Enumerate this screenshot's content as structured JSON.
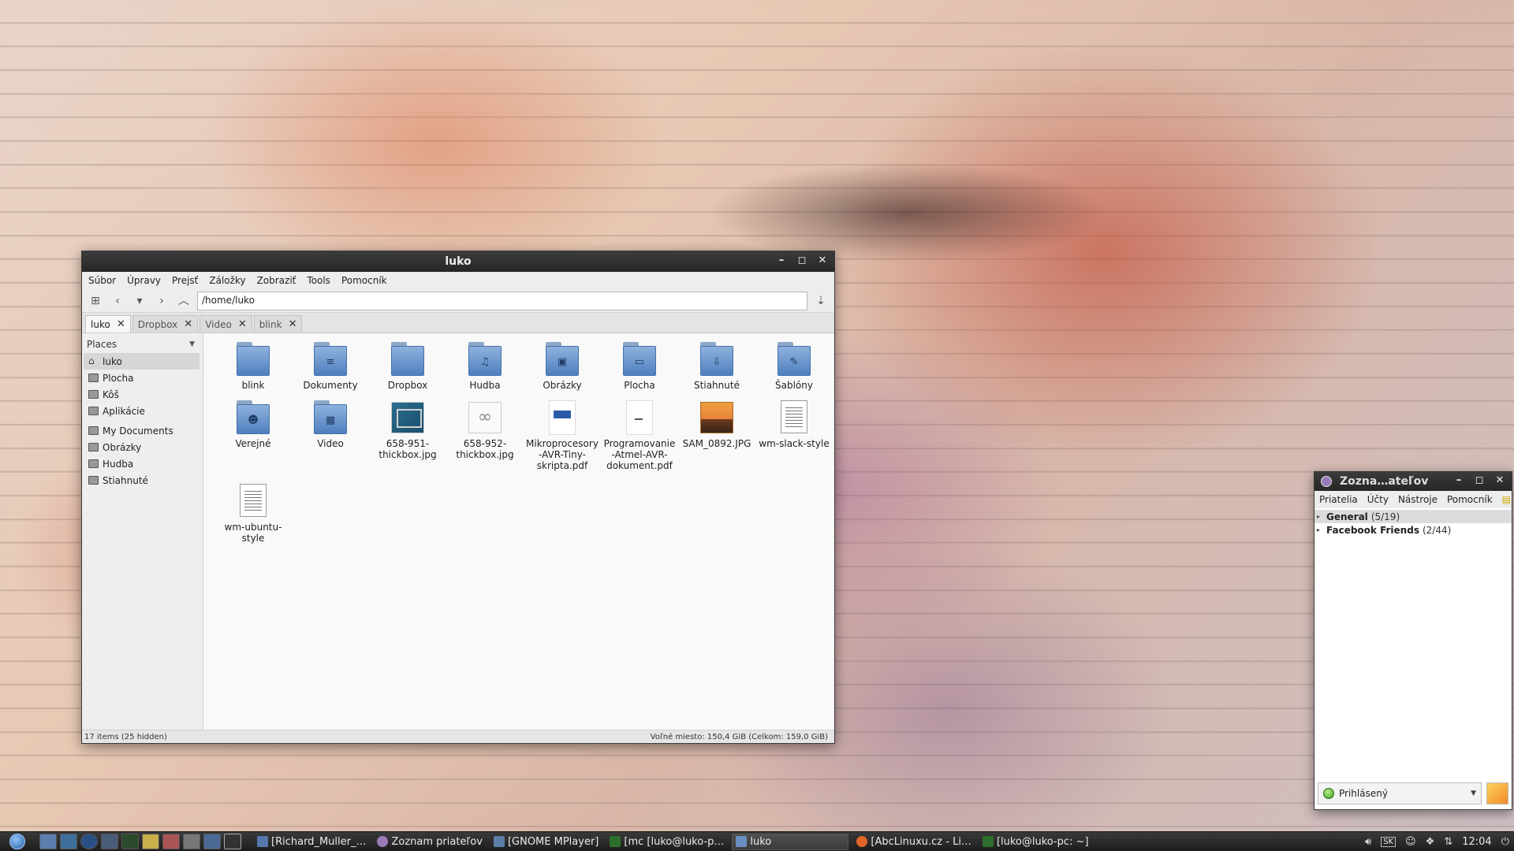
{
  "fm": {
    "title": "luko",
    "menu": [
      "Súbor",
      "Úpravy",
      "Prejsť",
      "Záložky",
      "Zobraziť",
      "Tools",
      "Pomocník"
    ],
    "path": "/home/luko",
    "tabs": [
      "luko",
      "Dropbox",
      "Video",
      "blink"
    ],
    "places_label": "Places",
    "places": [
      "luko",
      "Plocha",
      "Kôš",
      "Aplikácie"
    ],
    "bookmarks": [
      "My Documents",
      "Obrázky",
      "Hudba",
      "Stiahnuté"
    ],
    "files": [
      {
        "name": "blink",
        "kind": "folder",
        "glyph": ""
      },
      {
        "name": "Dokumenty",
        "kind": "folder",
        "glyph": "≡"
      },
      {
        "name": "Dropbox",
        "kind": "folder",
        "glyph": ""
      },
      {
        "name": "Hudba",
        "kind": "folder",
        "glyph": "♫"
      },
      {
        "name": "Obrázky",
        "kind": "folder",
        "glyph": "▣"
      },
      {
        "name": "Plocha",
        "kind": "folder",
        "glyph": "▭"
      },
      {
        "name": "Stiahnuté",
        "kind": "folder",
        "glyph": "⇩"
      },
      {
        "name": "Šablóny",
        "kind": "folder",
        "glyph": "✎"
      },
      {
        "name": "Verejné",
        "kind": "folder",
        "glyph": "☻"
      },
      {
        "name": "Video",
        "kind": "folder",
        "glyph": "▦"
      },
      {
        "name": "658-951-thickbox.jpg",
        "kind": "image-board"
      },
      {
        "name": "658-952-thickbox.jpg",
        "kind": "image-board2"
      },
      {
        "name": "Mikroprocesory-AVR-Tiny-skripta.pdf",
        "kind": "pdf"
      },
      {
        "name": "Programovanie-Atmel-AVR-dokument.pdf",
        "kind": "pdf2"
      },
      {
        "name": "SAM_0892.JPG",
        "kind": "photo"
      },
      {
        "name": "wm-slack-style",
        "kind": "text"
      },
      {
        "name": "wm-ubuntu-style",
        "kind": "text"
      }
    ],
    "status_left": "17 items (25 hidden)",
    "status_right": "Voľné miesto: 150,4 GiB (Celkom: 159,0 GiB)"
  },
  "buddy": {
    "title": "Zozna…ateľov",
    "menu": [
      "Priatelia",
      "Účty",
      "Nástroje",
      "Pomocník"
    ],
    "groups": [
      {
        "name": "General",
        "count": "(5/19)"
      },
      {
        "name": "Facebook Friends",
        "count": "(2/44)"
      }
    ],
    "status": "Prihlásený"
  },
  "taskbar": {
    "tasks": [
      {
        "label": "[Richard_Muller_…",
        "color": "#5577aa"
      },
      {
        "label": "Zoznam priateľov",
        "color": "#9a7bb8"
      },
      {
        "label": "[GNOME MPlayer]",
        "color": "#5c7fa8"
      },
      {
        "label": "[mc [luko@luko-p…",
        "color": "#2d6f2d"
      },
      {
        "label": "luko",
        "color": "#6a8fc0"
      },
      {
        "label": "[AbcLinuxu.cz - Li…",
        "color": "#e0662a"
      },
      {
        "label": "[luko@luko-pc: ~]",
        "color": "#2d6f2d"
      }
    ],
    "lang": "SK",
    "clock": "12:04"
  }
}
